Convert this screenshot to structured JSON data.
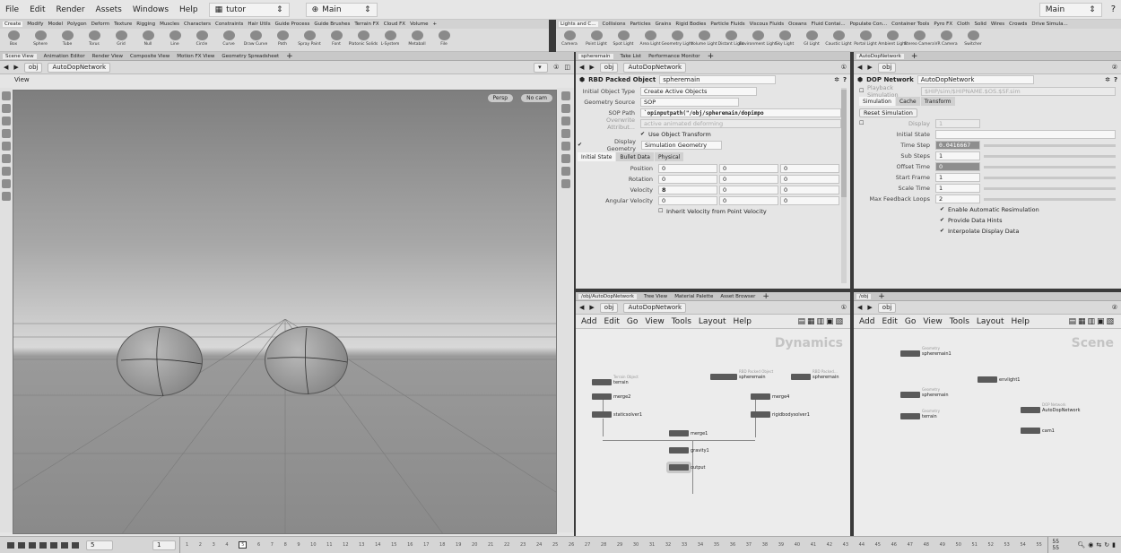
{
  "menubar": {
    "items": [
      "File",
      "Edit",
      "Render",
      "Assets",
      "Windows",
      "Help"
    ],
    "desktop_label": "tutor",
    "context_label": "Main",
    "right_label": "Main"
  },
  "shelf_tabs": {
    "left": [
      "Create",
      "Modify",
      "Model",
      "Polygon",
      "Deform",
      "Texture",
      "Rigging",
      "Muscles",
      "Characters",
      "Constraints",
      "Hair Utils",
      "Guide Process",
      "Guide Brushes",
      "Terrain FX",
      "Cloud FX",
      "Volume"
    ],
    "mid": [
      "Lights and C...",
      "Collisions",
      "Particles",
      "Grains",
      "Rigid Bodies",
      "Particle Fluids",
      "Viscous Fluids",
      "Oceans",
      "Fluid Contai...",
      "Populate Con...",
      "Container Tools",
      "Pyro FX",
      "Cloth",
      "Solid",
      "Wires",
      "Crowds",
      "Drive Simula..."
    ]
  },
  "shelf_tools": {
    "left": [
      "Box",
      "Sphere",
      "Tube",
      "Torus",
      "Grid",
      "Null",
      "Line",
      "Circle",
      "Curve",
      "Draw Curve",
      "Path",
      "Spray Paint",
      "Font",
      "Platonic Solids",
      "L-System",
      "Metaball",
      "File"
    ],
    "mid": [
      "Camera",
      "Point Light",
      "Spot Light",
      "Area Light",
      "Geometry Light",
      "Volume Light",
      "Distant Light",
      "Environment Light",
      "Sky Light",
      "GI Light",
      "Caustic Light",
      "Portal Light",
      "Ambient Light",
      "Stereo Camera",
      "VR Camera",
      "Switcher"
    ]
  },
  "left_pane": {
    "tabs": [
      "Scene View",
      "Animation Editor",
      "Render View",
      "Composite View",
      "Motion FX View",
      "Geometry Spreadsheet"
    ],
    "path_obj": "obj",
    "path_net": "AutoDopNetwork",
    "view_label": "View",
    "persp": "Persp",
    "nocam": "No cam"
  },
  "parm_pane": {
    "tabs": [
      "spheremain",
      "Take List",
      "Performance Monitor"
    ],
    "path_obj": "obj",
    "path_net": "AutoDopNetwork",
    "node_type": "RBD Packed Object",
    "node_name": "spheremain",
    "rows": [
      {
        "label": "Initial Object Type",
        "value": "Create Active Objects"
      },
      {
        "label": "Geometry Source",
        "value": "SOP"
      },
      {
        "label": "SOP Path",
        "value": "`opinputpath(\"/obj/spheremain/dopimpo"
      },
      {
        "label": "Overwrite Attribut...",
        "value": "active animated deforming"
      }
    ],
    "use_object_transform": "Use Object Transform",
    "display_geometry_label": "Display Geometry",
    "display_geometry_value": "Simulation Geometry",
    "subtabs": [
      "Initial State",
      "Bullet Data",
      "Physical"
    ],
    "vectors": [
      {
        "label": "Position",
        "v": [
          "0",
          "0",
          "0"
        ]
      },
      {
        "label": "Rotation",
        "v": [
          "0",
          "0",
          "0"
        ]
      },
      {
        "label": "Velocity",
        "v": [
          "8",
          "0",
          "0"
        ]
      },
      {
        "label": "Angular Velocity",
        "v": [
          "0",
          "0",
          "0"
        ]
      }
    ],
    "inherit": "Inherit Velocity from Point Velocity"
  },
  "dop_pane": {
    "tabs": [
      "AutoDopNetwork"
    ],
    "path_obj": "obj",
    "node_type": "DOP Network",
    "node_name": "AutoDopNetwork",
    "playback": "Playback Simulation",
    "playback_path": "$HIP/sim/$HIPNAME.$OS.$SF.sim",
    "subtabs": [
      "Simulation",
      "Cache",
      "Transform"
    ],
    "reset": "Reset Simulation",
    "rows": [
      {
        "label": "Display",
        "value": "1"
      },
      {
        "label": "Initial State",
        "value": ""
      },
      {
        "label": "Time Step",
        "value": "0.0416667"
      },
      {
        "label": "Sub Steps",
        "value": "1"
      },
      {
        "label": "Offset Time",
        "value": "0"
      },
      {
        "label": "Start Frame",
        "value": "1"
      },
      {
        "label": "Scale Time",
        "value": "1"
      },
      {
        "label": "Max Feedback Loops",
        "value": "2"
      }
    ],
    "checks": [
      "Enable Automatic Resimulation",
      "Provide Data Hints",
      "Interpolate Display Data"
    ]
  },
  "net_left": {
    "tabs": [
      "/obj/AutoDopNetwork",
      "Tree View",
      "Material Palette",
      "Asset Browser"
    ],
    "path_obj": "obj",
    "path_net": "AutoDopNetwork",
    "menu": [
      "Add",
      "Edit",
      "Go",
      "View",
      "Tools",
      "Layout",
      "Help"
    ],
    "watermark": "Dynamics",
    "nodes": [
      {
        "name": "terrain",
        "sub": "Terrain Object"
      },
      {
        "name": "merge2",
        "sub": ""
      },
      {
        "name": "staticsolver1",
        "sub": ""
      },
      {
        "name": "spheremain",
        "sub": "RBD Packed Object"
      },
      {
        "name": "spheremain",
        "sub": "RBD Packed..."
      },
      {
        "name": "merge4",
        "sub": ""
      },
      {
        "name": "rigidbodysolver1",
        "sub": ""
      },
      {
        "name": "merge1",
        "sub": ""
      },
      {
        "name": "gravity1",
        "sub": ""
      },
      {
        "name": "output",
        "sub": ""
      }
    ]
  },
  "net_right": {
    "tabs": [
      "/obj"
    ],
    "path_obj": "obj",
    "menu": [
      "Add",
      "Edit",
      "Go",
      "View",
      "Tools",
      "Layout",
      "Help"
    ],
    "watermark": "Scene",
    "nodes": [
      {
        "name": "spheremain1",
        "sub": "Geometry"
      },
      {
        "name": "envlight1",
        "sub": ""
      },
      {
        "name": "spheremain",
        "sub": "Geometry"
      },
      {
        "name": "terrain",
        "sub": "Geometry"
      },
      {
        "name": "AutoDopNetwork",
        "sub": "DOP Network"
      },
      {
        "name": "cam1",
        "sub": ""
      }
    ]
  },
  "timeline": {
    "current_frame": "5",
    "start": "1",
    "end_top": "55",
    "end_bottom": "55",
    "ticks": [
      "1",
      "2",
      "3",
      "4",
      "5",
      "6",
      "7",
      "8",
      "9",
      "10",
      "11",
      "12",
      "13",
      "14",
      "15",
      "16",
      "17",
      "18",
      "19",
      "20",
      "21",
      "22",
      "23",
      "24",
      "25",
      "26",
      "27",
      "28",
      "29",
      "30",
      "31",
      "32",
      "33",
      "34",
      "35",
      "36",
      "37",
      "38",
      "39",
      "40",
      "41",
      "42",
      "43",
      "44",
      "45",
      "46",
      "47",
      "48",
      "49",
      "50",
      "51",
      "52",
      "53",
      "54",
      "55"
    ]
  }
}
